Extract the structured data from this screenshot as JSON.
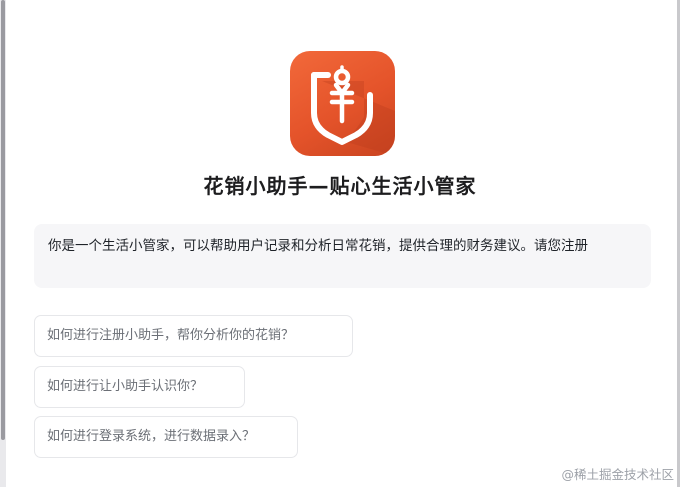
{
  "app": {
    "logo_icon": "receipt-yuan-icon",
    "title": "花销小助手—贴心生活小管家"
  },
  "intro": {
    "text": "你是一个生活小管家，可以帮助用户记录和分析日常花销，提供合理的财务建议。请您注册"
  },
  "suggestions": [
    {
      "label": "如何进行注册小助手，帮你分析你的花销？"
    },
    {
      "label": "如何进行让小助手认识你？"
    },
    {
      "label": "如何进行登录系统，进行数据录入？"
    }
  ],
  "watermark": "@稀土掘金技术社区",
  "colors": {
    "logo_orange": "#e4532a",
    "intro_bg": "#f6f6f8",
    "question_border": "#e6e7ea"
  }
}
